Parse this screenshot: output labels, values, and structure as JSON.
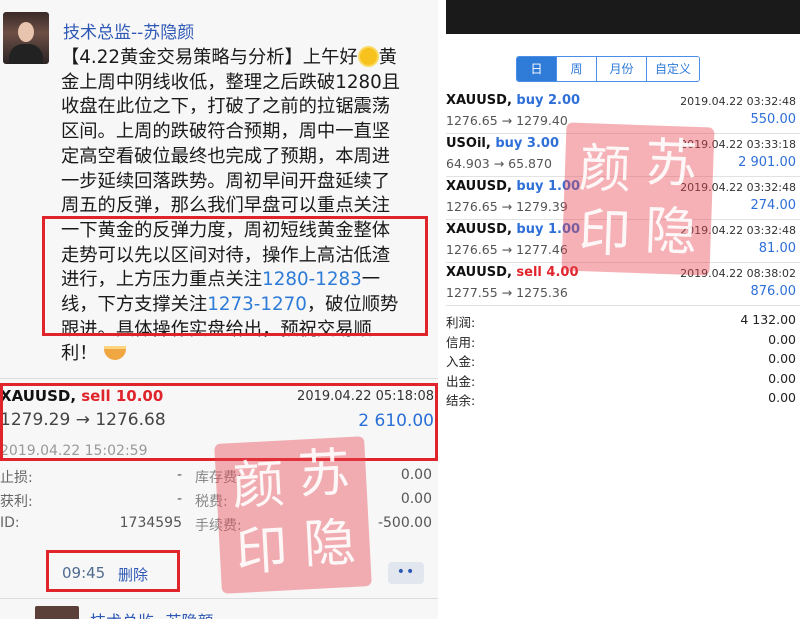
{
  "left": {
    "sender": "技术总监--苏隐颜",
    "post_lines": [
      {
        "a": "【4.22黄金交易策略与分析】上午好",
        "sun": true,
        "b": "黄"
      },
      {
        "a": "金上周中阴线收低，整理之后跌破1280且"
      },
      {
        "a": "收盘在此位之下，打破了之前的拉锯震荡"
      },
      {
        "a": "区间。上周的跌破符合预期，周中一直坚"
      },
      {
        "a": "定高空看破位最终也完成了预期，本周进"
      },
      {
        "a": "一步延续回落跌势。周初早间开盘延续了"
      },
      {
        "a": "周五的反弹，那么我们早盘可以重点关注"
      },
      {
        "a": "一下黄金的反弹力度，周初短线黄金整体"
      },
      {
        "a": "走势可以先以区间对待，操作上高沽低渣"
      },
      {
        "a": "进行，上方压力重点关注",
        "blue": "1280-1283",
        "b": "一"
      },
      {
        "a": "线，下方支撑关注",
        "blue": "1273-1270",
        "b": "，破位顺势"
      },
      {
        "a": "跟进。具体操作实盘给出，预祝交易顺"
      },
      {
        "a": "利！",
        "bowl": true
      }
    ],
    "trade": {
      "symbol": "XAUUSD, ",
      "side": "sell 10.00",
      "close_time": "2019.04.22 05:18:08",
      "price": "1279.29 → 1276.68",
      "profit": "2 610.00",
      "open_time": "2019.04.22 15:02:59"
    },
    "details": [
      {
        "l1": "止损:",
        "v1": "-",
        "l2": "库存费:",
        "v2": "0.00"
      },
      {
        "l1": "获利:",
        "v1": "-",
        "l2": "税费:",
        "v2": "0.00"
      },
      {
        "l1": "ID:",
        "v1": "1734595",
        "l2": "手续费:",
        "v2": "-500.00"
      }
    ],
    "meta": {
      "time": "09:45",
      "delete": "删除",
      "more": "••"
    },
    "next_sender": "技术总监--苏隐颜"
  },
  "right": {
    "tabs": [
      {
        "label": "日",
        "active": true
      },
      {
        "label": "周",
        "active": false
      },
      {
        "label": "月份",
        "active": false
      },
      {
        "label": "自定义",
        "active": false
      }
    ],
    "orders": [
      {
        "symbol": "XAUUSD, ",
        "side": "buy 2.00",
        "type": "buy",
        "time": "2019.04.22 03:32:48",
        "price": "1276.65 → 1279.40",
        "profit": "550.00"
      },
      {
        "symbol": "USOil, ",
        "side": "buy 3.00",
        "type": "buy",
        "time": "2019.04.22 03:33:18",
        "price": "64.903 → 65.870",
        "profit": "2 901.00"
      },
      {
        "symbol": "XAUUSD, ",
        "side": "buy 1.00",
        "type": "buy",
        "time": "2019.04.22 03:32:48",
        "price": "1276.65 → 1279.39",
        "profit": "274.00"
      },
      {
        "symbol": "XAUUSD, ",
        "side": "buy 1.00",
        "type": "buy",
        "time": "2019.04.22 03:32:48",
        "price": "1276.65 → 1277.46",
        "profit": "81.00"
      },
      {
        "symbol": "XAUUSD, ",
        "side": "sell 4.00",
        "type": "sell",
        "time": "2019.04.22 08:38:02",
        "price": "1277.55 → 1275.36",
        "profit": "876.00"
      }
    ],
    "summary": [
      {
        "k": "利润:",
        "v": "4 132.00"
      },
      {
        "k": "信用:",
        "v": "0.00"
      },
      {
        "k": "入金:",
        "v": "0.00"
      },
      {
        "k": "出金:",
        "v": "0.00"
      },
      {
        "k": "结余:",
        "v": "0.00"
      }
    ]
  },
  "seal": {
    "chars": [
      "颜",
      "苏",
      "印",
      "隐"
    ]
  },
  "colors": {
    "red_box": "#e0242c",
    "blue": "#2e6fd8",
    "sell": "#e0242c",
    "link": "#2e58b5"
  }
}
